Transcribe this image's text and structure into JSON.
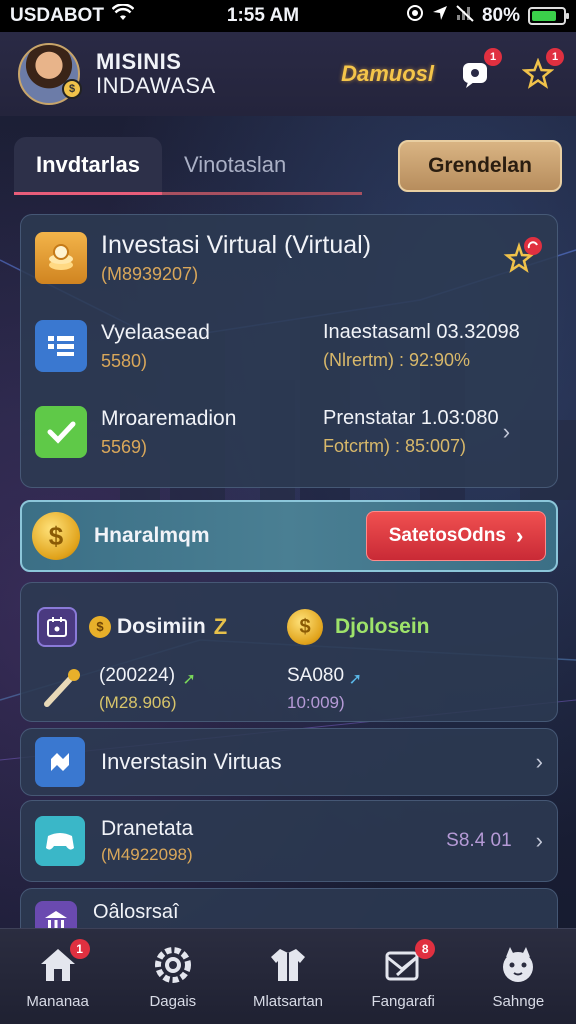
{
  "status_bar": {
    "carrier": "USDABOT",
    "time": "1:55 AM",
    "battery": "80%",
    "battery_level": 0.8,
    "icons": [
      "wifi-icon",
      "screen-record-icon",
      "location-icon",
      "signal-off-icon",
      "battery-icon"
    ]
  },
  "header": {
    "user_name": "MISINIS",
    "user_subtitle": "INDAWASA",
    "brand": "Damuosl",
    "messages_badge": "1",
    "notifications_badge": "1"
  },
  "tabs": {
    "items": [
      {
        "label": "Invdtarlas",
        "active": true
      },
      {
        "label": "Vinotaslan",
        "active": false
      }
    ],
    "action_label": "Grendelan"
  },
  "investment_card": {
    "title": "Investasi Virtual (Virtual)",
    "subtitle": "(M8939207)",
    "rows": [
      {
        "icon": "list-icon",
        "label": "Vyelaasead",
        "value": "5580)",
        "right_label": "Inaestasaml 03.32098",
        "right_value": "(Nlrertm) : 92:90%"
      },
      {
        "icon": "check-icon",
        "label": "Mroaremadion",
        "value": "5569)",
        "right_label": "Prenstatar 1.03:080",
        "right_value": "Fotcrtm) : 85:007)"
      }
    ]
  },
  "banner": {
    "title": "Hnaralmqm",
    "cta_label": "SatetosOdns"
  },
  "stats": {
    "left_title": "Dosimiin",
    "left_mark": "Z",
    "right_title": "Djolosein",
    "left_value": "(200224)",
    "left_subvalue": "(M28.906)",
    "right_value": "SA080",
    "right_subvalue": "10:009)"
  },
  "list": [
    {
      "icon": "puzzle-icon",
      "title": "Inverstasin Virtuas",
      "subtitle": "",
      "value": ""
    },
    {
      "icon": "game-controller-icon",
      "title": "Dranetata",
      "subtitle": "(M4922098)",
      "value": "S8.4 01"
    },
    {
      "icon": "bank-icon",
      "title": "Oâlosrsaî",
      "subtitle": "",
      "value": ""
    }
  ],
  "bottom_nav": [
    {
      "label": "Mananaa",
      "icon": "home-icon",
      "badge": "1"
    },
    {
      "label": "Dagais",
      "icon": "settings-gear-icon",
      "badge": ""
    },
    {
      "label": "Mlatsartan",
      "icon": "shirt-icon",
      "badge": ""
    },
    {
      "label": "Fangarafi",
      "icon": "inbox-icon",
      "badge": "8"
    },
    {
      "label": "Sahnge",
      "icon": "pet-icon",
      "badge": ""
    }
  ],
  "colors": {
    "accent_gold": "#d9a75a",
    "cta_red": "#d8333e",
    "banner_teal": "#4a7f93",
    "badge_red": "#e03040",
    "success_green": "#5fc948",
    "info_blue": "#3a78d0"
  }
}
